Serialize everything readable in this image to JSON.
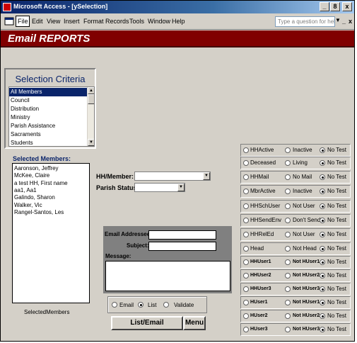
{
  "window": {
    "title": "Microsoft Access - [ySelection]",
    "controls": [
      "_",
      "8",
      "x"
    ]
  },
  "menubar": {
    "items": [
      "File",
      "Edit",
      "View",
      "Insert",
      "Format",
      "Records",
      "Tools",
      "Window",
      "Help"
    ],
    "ask_placeholder": "Type a question for help",
    "mdi_controls": [
      "_",
      "8",
      "x"
    ]
  },
  "form": {
    "header_title": "Email REPORTS"
  },
  "criteria": {
    "title": "Selection Criteria",
    "items": [
      "All Members",
      "Council",
      "Distribution",
      "Ministry",
      "Parish Assistance",
      "Sacraments",
      "Students"
    ],
    "selected_index": 0
  },
  "members": {
    "label": "Selected Members:",
    "items": [
      "Aaronson, Jeffrey",
      "McKee, Claire",
      "a test HH, First name",
      "aa1, Aa1",
      "Galindo, Sharon",
      "Walker, Vic",
      "Rangel-Santos, Les"
    ],
    "caption": "SelectedMembers"
  },
  "hh": {
    "member_label": "HH/Member:",
    "member_value": "",
    "status_label": "Parish Status:",
    "status_value": ""
  },
  "email": {
    "address_label": "Email Addressee:",
    "address_value": "",
    "subject_label": "Subject:",
    "subject_value": "",
    "message_label": "Message:",
    "message_value": ""
  },
  "output_options": {
    "options": [
      "Email",
      "List",
      "Validate"
    ],
    "selected_index": 1
  },
  "buttons": {
    "list_email": "List/Email",
    "menu": "Menu"
  },
  "filters": [
    {
      "a": "HHActive",
      "b": "Inactive",
      "c": "No Test",
      "selected": 2,
      "small": false
    },
    {
      "a": "Deceased",
      "b": "Living",
      "c": "No Test",
      "selected": 2,
      "small": false
    },
    {
      "a": "HHMail",
      "b": "No Mail",
      "c": "No Test",
      "selected": 2,
      "small": false
    },
    {
      "a": "MbrActive",
      "b": "Inactive",
      "c": "No Test",
      "selected": 2,
      "small": false
    },
    {
      "a": "HHSchUser",
      "b": "Not User",
      "c": "No Test",
      "selected": 2,
      "small": false
    },
    {
      "a": "HHSendEnv",
      "b": "Don't Send",
      "c": "No Test",
      "selected": 2,
      "small": false
    },
    {
      "a": "HHRelEd",
      "b": "Not User",
      "c": "No Test",
      "selected": 2,
      "small": false
    },
    {
      "a": "Head",
      "b": "Not Head",
      "c": "No Test",
      "selected": 2,
      "small": false
    },
    {
      "a": "HHUser1",
      "b": "Not HUser1",
      "c": "No Test",
      "selected": 2,
      "small": true
    },
    {
      "a": "HHUser2",
      "b": "Not HUser2",
      "c": "No Test",
      "selected": 2,
      "small": true
    },
    {
      "a": "HHUser3",
      "b": "Not HUser3",
      "c": "No Test",
      "selected": 2,
      "small": true
    },
    {
      "a": "HUser1",
      "b": "Not HUser1",
      "c": "No Test",
      "selected": 2,
      "small": true
    },
    {
      "a": "HUser2",
      "b": "Not HUser2",
      "c": "No Test",
      "selected": 2,
      "small": true
    },
    {
      "a": "HUser3",
      "b": "Not HUser3",
      "c": "No Test",
      "selected": 2,
      "small": true
    }
  ],
  "colors": {
    "title_bar": "#0a246a",
    "header_band": "#800000",
    "form_bg": "#d4d0c8",
    "email_panel": "#808080",
    "criteria_title": "#0a246a"
  }
}
